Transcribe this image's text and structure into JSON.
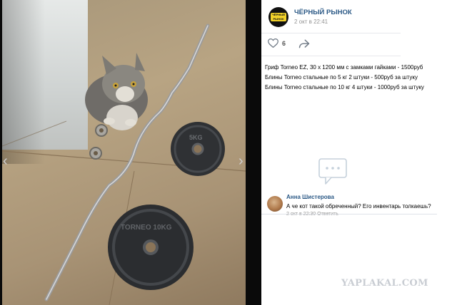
{
  "group": {
    "name": "ЧЁРНЫЙ РЫНОК",
    "date": "2 окт в 22:41",
    "avatar_icon": "black-market-logo"
  },
  "actions": {
    "like_count": "6",
    "like_icon": "heart-icon",
    "share_icon": "share-arrow-icon"
  },
  "post": {
    "lines": [
      "Гриф Torneo EZ, 30 х 1200 мм с замками гайками - 1500руб",
      "Блины Torneo стальные по 5 кг 2 штуки - 500руб за штуку",
      "Блины Torneo стальные по 10 кг 4 штуки - 1000руб за штуку"
    ]
  },
  "comments": {
    "placeholder_icon": "comments-icon",
    "items": [
      {
        "author": "Анна Шистерова",
        "text": "А че кот такой обреченный? Его инвентарь толкаешь?",
        "meta": "2 окт в 22:30   Ответить"
      }
    ]
  },
  "viewer": {
    "prev_icon": "chevron-left-icon",
    "next_icon": "chevron-right-icon",
    "plate_small_label": "5KG",
    "plate_large_label": "TORNEO 10KG"
  },
  "watermark": "YAPLAKAL.COM",
  "colors": {
    "link": "#2a5885",
    "muted": "#939393",
    "panel_bg": "#ffffff",
    "viewer_bg": "#000000"
  }
}
